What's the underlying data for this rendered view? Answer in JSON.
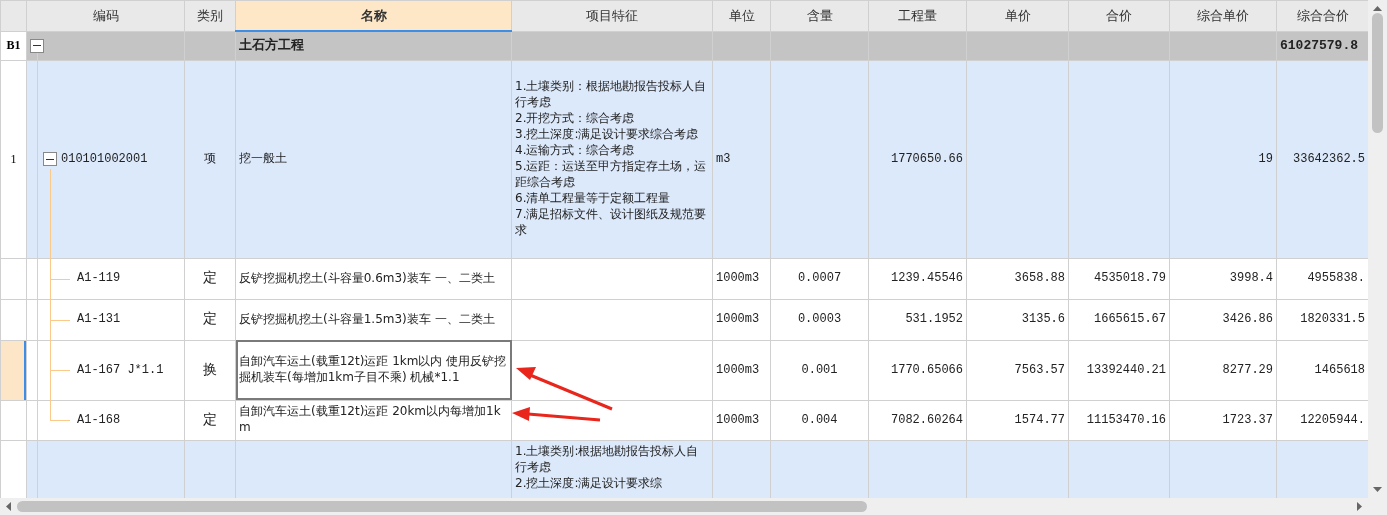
{
  "columns": [
    {
      "label": "编码",
      "selected": false
    },
    {
      "label": "类别",
      "selected": false
    },
    {
      "label": "名称",
      "selected": true
    },
    {
      "label": "项目特征",
      "selected": false
    },
    {
      "label": "单位",
      "selected": false
    },
    {
      "label": "含量",
      "selected": false
    },
    {
      "label": "工程量",
      "selected": false
    },
    {
      "label": "单价",
      "selected": false
    },
    {
      "label": "合价",
      "selected": false
    },
    {
      "label": "综合单价",
      "selected": false
    },
    {
      "label": "综合合价",
      "selected": false
    }
  ],
  "group": {
    "row_label": "B1",
    "expanded": true,
    "name": "土石方工程",
    "comp_total": "61027579.8",
    "children": [
      {
        "row_label": "1",
        "code": "010101002001",
        "expanded": true,
        "type": "项",
        "name": "挖一般土",
        "features": "1.土壤类别：根据地勘报告投标人自行考虑\n2.开挖方式：综合考虑\n3.挖土深度:满足设计要求综合考虑\n4.运输方式：综合考虑\n5.运距：运送至甲方指定存土场，运距综合考虑\n6.清单工程量等于定额工程量\n7.满足招标文件、设计图纸及规范要求",
        "unit": "m3",
        "quantity": "1770650.66",
        "comp_price": "19",
        "comp_total": "33642362.5",
        "children": [
          {
            "code": "A1-119",
            "type": "定",
            "name": "反铲挖掘机挖土(斗容量0.6m3)装车 一、二类土",
            "unit": "1000m3",
            "content": "0.0007",
            "quantity": "1239.45546",
            "price": "3658.88",
            "total": "4535018.79",
            "comp_price": "3998.4",
            "comp_total": "4955838.",
            "selected": false
          },
          {
            "code": "A1-131",
            "type": "定",
            "name": "反铲挖掘机挖土(斗容量1.5m3)装车 一、二类土",
            "unit": "1000m3",
            "content": "0.0003",
            "quantity": "531.1952",
            "price": "3135.6",
            "total": "1665615.67",
            "comp_price": "3426.86",
            "comp_total": "1820331.5",
            "selected": false
          },
          {
            "code": "A1-167 J*1.1",
            "type": "换",
            "name": "自卸汽车运土(载重12t)运距 1km以内 使用反铲挖掘机装车(每增加1km子目不乘) 机械*1.1",
            "unit": "1000m3",
            "content": "0.001",
            "quantity": "1770.65066",
            "price": "7563.57",
            "total": "13392440.21",
            "comp_price": "8277.29",
            "comp_total": "1465618",
            "selected": true
          },
          {
            "code": "A1-168",
            "type": "定",
            "name": "自卸汽车运土(载重12t)运距 20km以内每增加1km",
            "unit": "1000m3",
            "content": "0.004",
            "quantity": "7082.60264",
            "price": "1574.77",
            "total": "11153470.16",
            "comp_price": "1723.37",
            "comp_total": "12205944.",
            "selected": false
          }
        ]
      },
      {
        "features": "1.土壤类别:根据地勘报告投标人自行考虑\n2.挖土深度:满足设计要求综"
      }
    ]
  }
}
